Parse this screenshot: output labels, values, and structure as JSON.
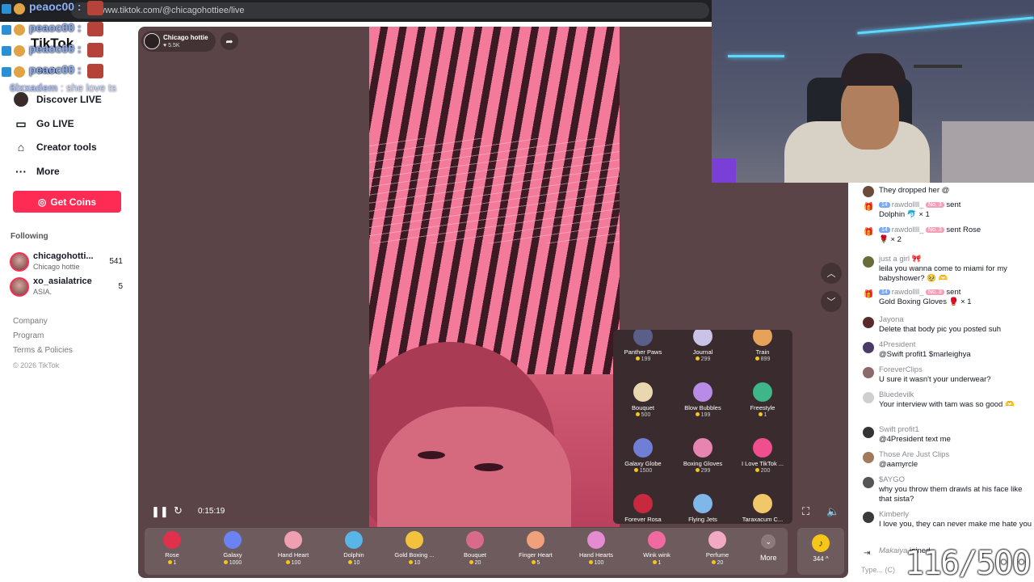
{
  "browser": {
    "url": "www.tiktok.com/@chicagohottiee/live"
  },
  "overlay": {
    "chat_rows": [
      {
        "name": "peaoc00 :"
      },
      {
        "name": "peaoc00 :"
      },
      {
        "name": "peaoc00 :"
      },
      {
        "name": "peaoc00 :"
      }
    ],
    "message_user": "6lxxadem",
    "message_text": " : she love ts"
  },
  "sidebar": {
    "logo": "TikTok",
    "back": "Back",
    "nav": [
      {
        "label": "Discover LIVE",
        "icon": "avatar-icon"
      },
      {
        "label": "Go LIVE",
        "icon": "video-camera-icon"
      },
      {
        "label": "Creator tools",
        "icon": "creator-tools-icon"
      },
      {
        "label": "More",
        "icon": "more-dots-icon"
      }
    ],
    "get_coins": "Get Coins",
    "following_title": "Following",
    "following": [
      {
        "name": "chicagohotti...",
        "sub": "Chicago hottie",
        "count": "541"
      },
      {
        "name": "xo_asialatrice",
        "sub": "ASIA.",
        "count": "5"
      }
    ],
    "links": [
      "Company",
      "Program",
      "Terms & Policies"
    ],
    "copyright": "© 2026 TikTok"
  },
  "live": {
    "host_name": "Chicago hottie",
    "host_likes": "♥ 5.5K",
    "timer": "0:15:19"
  },
  "gift_grid": [
    {
      "name": "Panther Paws",
      "price": "199",
      "color": "#5a5f8a"
    },
    {
      "name": "Journal",
      "price": "299",
      "color": "#c9c3e8"
    },
    {
      "name": "Train",
      "price": "899",
      "color": "#e7a25a"
    },
    {
      "name": "Bouquet",
      "price": "500",
      "color": "#e9d7b0"
    },
    {
      "name": "Blow Bubbles",
      "price": "199",
      "color": "#b78be6"
    },
    {
      "name": "Freestyle",
      "price": "1",
      "color": "#3fb58a"
    },
    {
      "name": "Galaxy Globe",
      "price": "1500",
      "color": "#6f7fd6"
    },
    {
      "name": "Boxing Gloves",
      "price": "299",
      "color": "#e884b0"
    },
    {
      "name": "I Love TikTok ...",
      "price": "200",
      "color": "#ef4f8d"
    },
    {
      "name": "Forever Rosa",
      "price": "",
      "color": "#c8293f"
    },
    {
      "name": "Flying Jets",
      "price": "",
      "color": "#7fb7e8"
    },
    {
      "name": "Taraxacum C...",
      "price": "",
      "color": "#f0c86a"
    }
  ],
  "tray": [
    {
      "name": "Rose",
      "price": "1",
      "color": "#e0304c"
    },
    {
      "name": "Galaxy",
      "price": "1000",
      "color": "#6a82f2"
    },
    {
      "name": "Hand Heart",
      "price": "100",
      "color": "#f09fb0"
    },
    {
      "name": "Dolphin",
      "price": "10",
      "color": "#59b4e8"
    },
    {
      "name": "Gold Boxing ...",
      "price": "10",
      "color": "#f2c23e"
    },
    {
      "name": "Bouquet",
      "price": "20",
      "color": "#d86b8a"
    },
    {
      "name": "Finger Heart",
      "price": "5",
      "color": "#f0a07a"
    },
    {
      "name": "Hand Hearts",
      "price": "100",
      "color": "#e58bd1"
    },
    {
      "name": "Wink wink",
      "price": "1",
      "color": "#f06aa0"
    },
    {
      "name": "Perfume",
      "price": "20",
      "color": "#f3a8c4"
    }
  ],
  "tray_more": "More",
  "coin_balance": "344 ^",
  "chat": {
    "messages": [
      {
        "type": "text",
        "user": "",
        "text": "They dropped her @",
        "avatar": "#6b4a3a"
      },
      {
        "type": "gift",
        "level": "14",
        "user": "rawdollll_",
        "badge": "No. 3",
        "action": "sent",
        "text": "Dolphin 🐬 × 1"
      },
      {
        "type": "gift",
        "level": "14",
        "user": "rawdollll_",
        "badge": "No. 3",
        "action": "sent Rose",
        "text": "🌹 × 2"
      },
      {
        "type": "text",
        "user": "just a girl 🎀",
        "text": "leila you wanna come to miami for my babyshower? 🥹 🫶",
        "avatar": "#6a6a3a"
      },
      {
        "type": "gift",
        "level": "14",
        "user": "rawdollll_",
        "badge": "No. 3",
        "action": "sent",
        "text": "Gold Boxing Gloves 🥊 × 1"
      },
      {
        "type": "text",
        "user": "Jayona",
        "text": "Delete that body pic you posted suh",
        "avatar": "#5a2a2a"
      },
      {
        "type": "text",
        "user": "4President",
        "text": "@Swift profit1 $marleighya",
        "avatar": "#4a3a6a"
      },
      {
        "type": "text",
        "user": "ForeverClips",
        "text": "U sure it wasn't your underwear?",
        "avatar": "#8a6a6a"
      },
      {
        "type": "text",
        "user": "Bluedevilk",
        "text": "Your interview with tam was so good 🫶",
        "avatar": "#cfcfcf"
      },
      {
        "type": "text",
        "user": "Swift profit1",
        "text": "@4President text me",
        "avatar": "#333333"
      },
      {
        "type": "text",
        "user": "Those Are Just Clips",
        "text": "@aamyrcle",
        "avatar": "#a07a5a"
      },
      {
        "type": "text",
        "user": "$AYGO",
        "text": "why you throw them drawls at his face like that sista?",
        "avatar": "#555555"
      },
      {
        "type": "text",
        "user": "Kimberly",
        "text": "I love you, they can never make me hate you",
        "avatar": "#3a3a3a"
      }
    ],
    "joined_user": "Makaiya",
    "joined_text": " joined",
    "input_placeholder": "Type... (C)"
  },
  "stream_counter": "116/500"
}
